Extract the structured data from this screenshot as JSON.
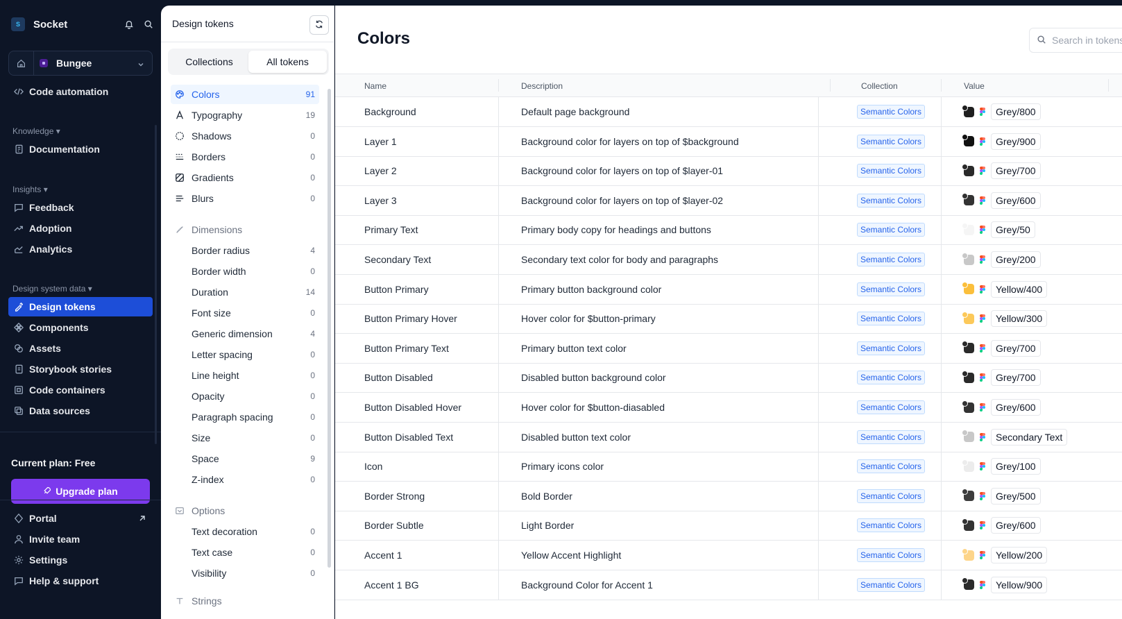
{
  "app": {
    "name": "Socket",
    "logo_text": "S"
  },
  "workspace": {
    "name": "Bungee"
  },
  "nav": {
    "code_automation": "Code automation",
    "knowledge_label": "Knowledge",
    "documentation": "Documentation",
    "insights_label": "Insights",
    "feedback": "Feedback",
    "adoption": "Adoption",
    "analytics": "Analytics",
    "dsd_label": "Design system data",
    "design_tokens": "Design tokens",
    "components": "Components",
    "assets": "Assets",
    "storybook": "Storybook stories",
    "code_containers": "Code containers",
    "data_sources": "Data sources",
    "plan": "Current plan: Free",
    "upgrade": "Upgrade plan",
    "portal": "Portal",
    "invite": "Invite team",
    "settings": "Settings",
    "help": "Help & support"
  },
  "tokens_panel": {
    "title": "Design tokens",
    "tab_collections": "Collections",
    "tab_all": "All tokens",
    "items": [
      {
        "label": "Colors",
        "count": "91"
      },
      {
        "label": "Typography",
        "count": "19"
      },
      {
        "label": "Shadows",
        "count": "0"
      },
      {
        "label": "Borders",
        "count": "0"
      },
      {
        "label": "Gradients",
        "count": "0"
      },
      {
        "label": "Blurs",
        "count": "0"
      }
    ],
    "dimensions_label": "Dimensions",
    "dimensions": [
      {
        "label": "Border radius",
        "count": "4"
      },
      {
        "label": "Border width",
        "count": "0"
      },
      {
        "label": "Duration",
        "count": "14"
      },
      {
        "label": "Font size",
        "count": "0"
      },
      {
        "label": "Generic dimension",
        "count": "4"
      },
      {
        "label": "Letter spacing",
        "count": "0"
      },
      {
        "label": "Line height",
        "count": "0"
      },
      {
        "label": "Opacity",
        "count": "0"
      },
      {
        "label": "Paragraph spacing",
        "count": "0"
      },
      {
        "label": "Size",
        "count": "0"
      },
      {
        "label": "Space",
        "count": "9"
      },
      {
        "label": "Z-index",
        "count": "0"
      }
    ],
    "options_label": "Options",
    "options": [
      {
        "label": "Text decoration",
        "count": "0"
      },
      {
        "label": "Text case",
        "count": "0"
      },
      {
        "label": "Visibility",
        "count": "0"
      }
    ],
    "strings_label": "Strings"
  },
  "main": {
    "title": "Colors",
    "search_placeholder": "Search in tokens",
    "columns": {
      "name": "Name",
      "description": "Description",
      "collection": "Collection",
      "value": "Value"
    },
    "rows": [
      {
        "name": "Background",
        "description": "Default page background",
        "collection": "Semantic Colors",
        "value": "Grey/800",
        "color": "#1f1f1f"
      },
      {
        "name": "Layer 1",
        "description": "Background color for layers on top of $background",
        "collection": "Semantic Colors",
        "value": "Grey/900",
        "color": "#111111"
      },
      {
        "name": "Layer 2",
        "description": "Background color for layers on top of $layer-01",
        "collection": "Semantic Colors",
        "value": "Grey/700",
        "color": "#2a2a2a"
      },
      {
        "name": "Layer 3",
        "description": "Background color for layers on top of $layer-02",
        "collection": "Semantic Colors",
        "value": "Grey/600",
        "color": "#333333"
      },
      {
        "name": "Primary Text",
        "description": "Primary body copy for headings and buttons",
        "collection": "Semantic Colors",
        "value": "Grey/50",
        "color": "#f5f5f5"
      },
      {
        "name": "Secondary Text",
        "description": "Secondary text color for body and paragraphs",
        "collection": "Semantic Colors",
        "value": "Grey/200",
        "color": "#c8c8c8"
      },
      {
        "name": "Button Primary",
        "description": "Primary button background color",
        "collection": "Semantic Colors",
        "value": "Yellow/400",
        "color": "#fbbf3c"
      },
      {
        "name": "Button Primary Hover",
        "description": "Hover color for $button-primary",
        "collection": "Semantic Colors",
        "value": "Yellow/300",
        "color": "#fcc95a"
      },
      {
        "name": "Button Primary Text",
        "description": "Primary button text color",
        "collection": "Semantic Colors",
        "value": "Grey/700",
        "color": "#2a2a2a"
      },
      {
        "name": "Button Disabled",
        "description": "Disabled button background color",
        "collection": "Semantic Colors",
        "value": "Grey/700",
        "color": "#2a2a2a"
      },
      {
        "name": "Button Disabled Hover",
        "description": "Hover color for $button-diasabled",
        "collection": "Semantic Colors",
        "value": "Grey/600",
        "color": "#333333"
      },
      {
        "name": "Button Disabled Text",
        "description": "Disabled button text color",
        "collection": "Semantic Colors",
        "value": "Secondary Text",
        "color": "#c8c8c8"
      },
      {
        "name": "Icon",
        "description": "Primary icons color",
        "collection": "Semantic Colors",
        "value": "Grey/100",
        "color": "#ececec"
      },
      {
        "name": "Border Strong",
        "description": "Bold Border",
        "collection": "Semantic Colors",
        "value": "Grey/500",
        "color": "#3d3d3d"
      },
      {
        "name": "Border Subtle",
        "description": "Light Border",
        "collection": "Semantic Colors",
        "value": "Grey/600",
        "color": "#333333"
      },
      {
        "name": "Accent 1",
        "description": "Yellow Accent Highlight",
        "collection": "Semantic Colors",
        "value": "Yellow/200",
        "color": "#fdd58a"
      },
      {
        "name": "Accent 1 BG",
        "description": "Background Color for Accent 1",
        "collection": "Semantic Colors",
        "value": "Yellow/900",
        "color": "#2b2b2b"
      }
    ]
  },
  "colors": {
    "accent": "#1d4ed8",
    "upgrade": "#7c3aed",
    "nav_bg": "#0d1526"
  }
}
